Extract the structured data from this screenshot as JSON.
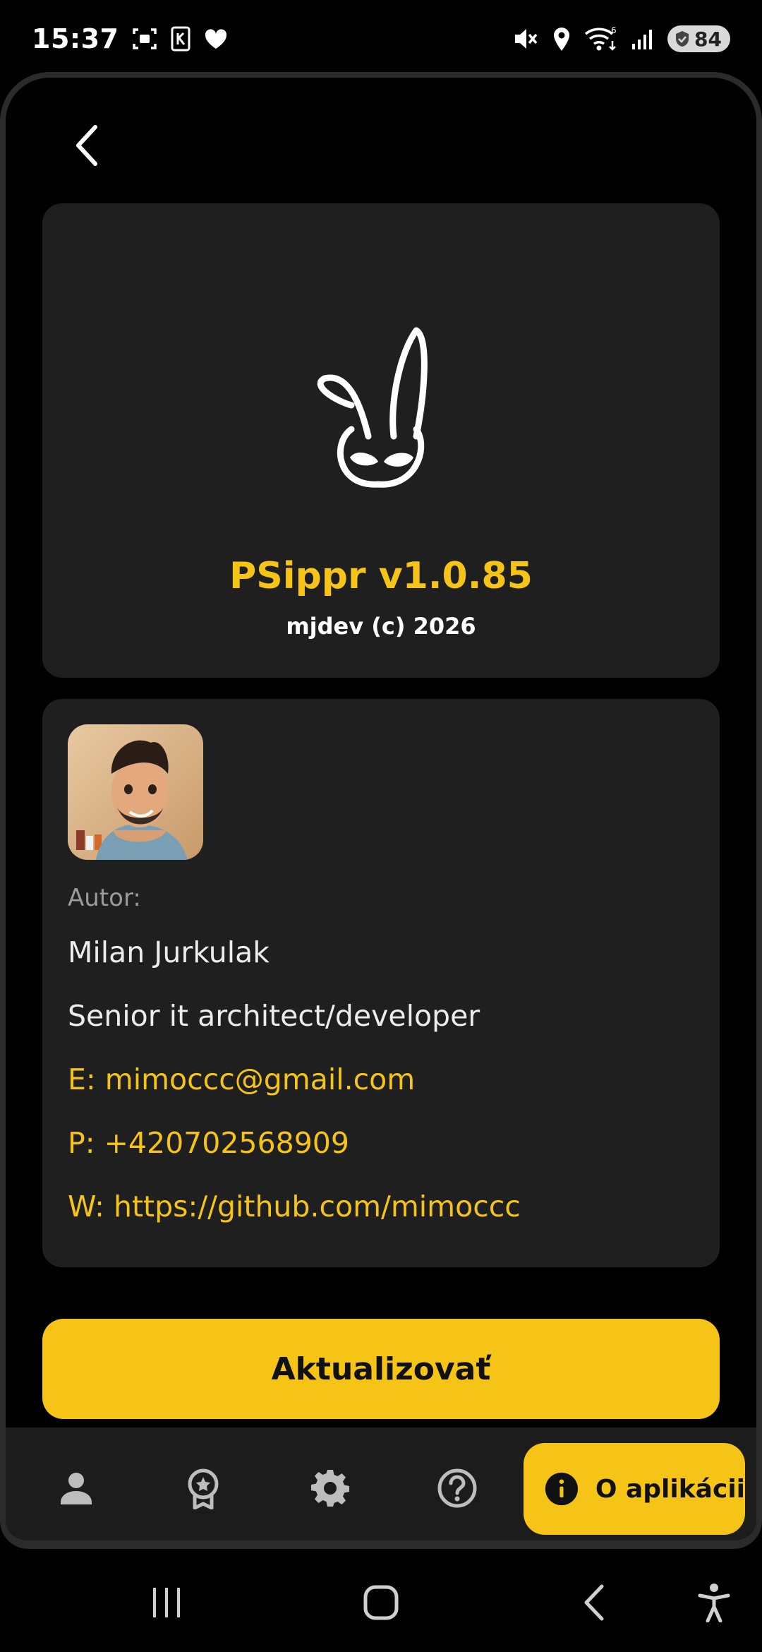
{
  "status_bar": {
    "time": "15:37",
    "battery": "84",
    "network_label": "6"
  },
  "about": {
    "app_title": "PSippr v1.0.85",
    "copyright": "mjdev (c) 2026"
  },
  "author": {
    "label": "Autor:",
    "name": "Milan Jurkulak",
    "role": "Senior it architect/developer",
    "email": "E: mimoccc@gmail.com",
    "phone": "P: +420702568909",
    "web": "W: https://github.com/mimoccc"
  },
  "update_button": "Aktualizovať",
  "tabs": [
    {
      "icon": "person-icon"
    },
    {
      "icon": "award-icon"
    },
    {
      "icon": "gear-icon"
    },
    {
      "icon": "help-icon"
    },
    {
      "icon": "info-icon",
      "label": "O aplikácii",
      "active": true
    }
  ],
  "colors": {
    "accent": "#f5c417",
    "card": "#1f1f1f",
    "background": "#000000"
  }
}
